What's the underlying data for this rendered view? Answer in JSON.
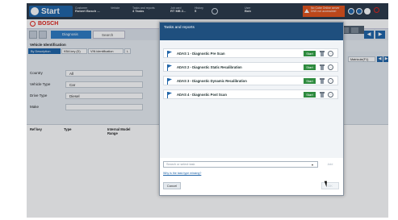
{
  "topbar": {
    "start_label": "Start",
    "customer_label": "Customer",
    "customer_value": "Robert Bosch ...",
    "vehicle_label": "Vehicle",
    "tasks_label": "Tasks and reports",
    "tasks_value": "4 Tasks",
    "jobcard_label": "Job card",
    "jobcard_value": "RT MB 2...",
    "history_label": "History",
    "history_value": "5",
    "user_label": "User",
    "user_value": "Bob",
    "alert_line1": "No Cube Online server",
    "alert_line2": "DNS not accessible!",
    "brand": "BOSCH"
  },
  "logo_row": {
    "brand": "BOSCH"
  },
  "nav": {
    "diagnosis_label": "Diagnosis",
    "search_label": "Search"
  },
  "vehicle_identification": {
    "title": "Vehicle Identification",
    "tabs": [
      "By Description",
      "KBA key (D)",
      "VIN identification",
      "L"
    ],
    "fields": [
      {
        "label": "Country",
        "value": "All"
      },
      {
        "label": "Vehicle Type",
        "value": "Car"
      },
      {
        "label": "Drive Type",
        "value": "Diesel"
      },
      {
        "label": "Make",
        "value": ""
      }
    ],
    "right_tab": "Matricule(F1)"
  },
  "table": {
    "columns": [
      "Ref key",
      "Type",
      "Internal Model Range"
    ]
  },
  "modal": {
    "title": "Tasks and reports",
    "tasks": [
      {
        "name": "ADAS 1 - Diagnostic Pre Scan",
        "start": "Start"
      },
      {
        "name": "ADAS 2 - Diagnostic Static Recalibration",
        "start": "Start"
      },
      {
        "name": "ADAS 3 - Diagnostic Dynamic Recalibration",
        "start": "Start"
      },
      {
        "name": "ADAS 4 - Diagnostic Post Scan",
        "start": "Start"
      }
    ],
    "search_placeholder": "Search or select task",
    "add_label": "Add",
    "missing_link": "Why is the task type missing?",
    "cancel_label": "Cancel",
    "ok_label": "OK"
  }
}
